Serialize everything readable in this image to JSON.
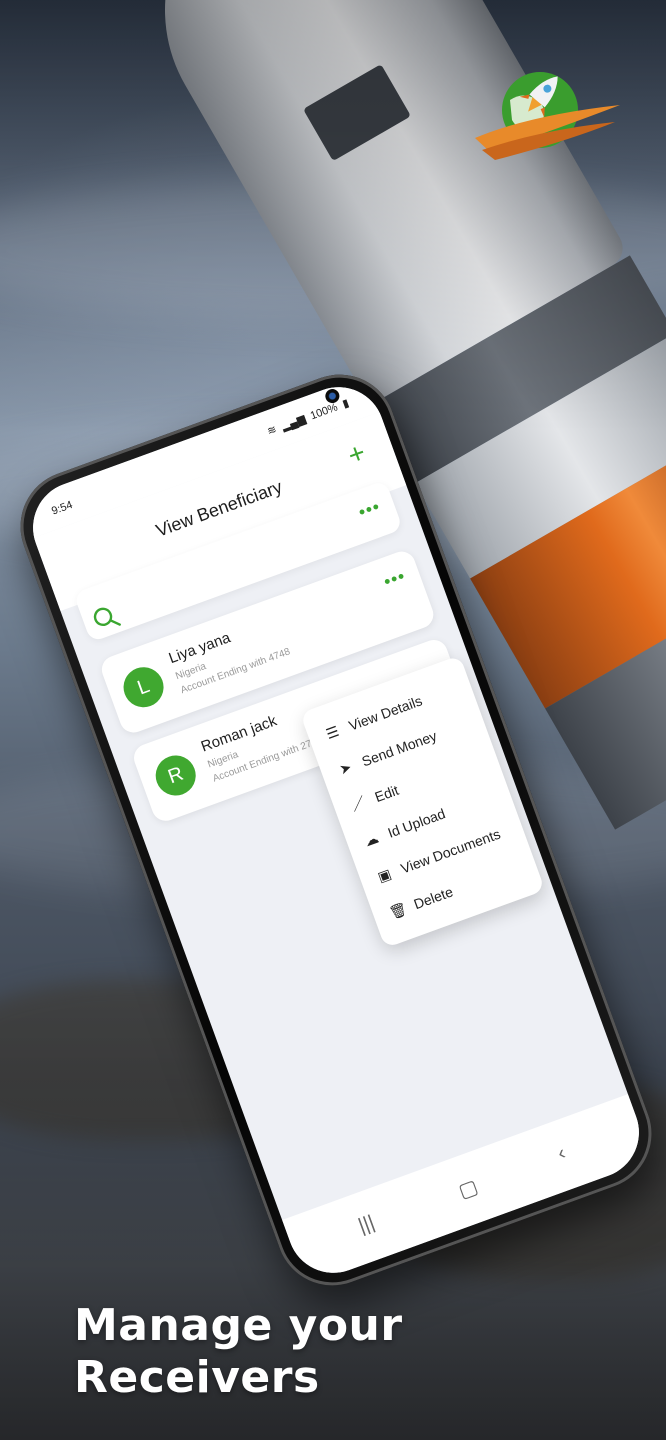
{
  "phone": {
    "status": {
      "time": "9:54",
      "battery": "100%"
    },
    "header": {
      "title": "View Beneficiary"
    },
    "beneficiaries": [
      {
        "initial": "L",
        "name": "Liya yana",
        "country": "Nigeria",
        "account": "Account Ending with 4748"
      },
      {
        "initial": "R",
        "name": "Roman jack",
        "country": "Nigeria",
        "account": "Account Ending with 2737"
      }
    ],
    "menu": [
      {
        "label": "View Details",
        "icon": "list-icon"
      },
      {
        "label": "Send Money",
        "icon": "send-icon"
      },
      {
        "label": "Edit",
        "icon": "edit-icon"
      },
      {
        "label": "Id Upload",
        "icon": "cloud-upload-icon"
      },
      {
        "label": "View Documents",
        "icon": "image-icon"
      },
      {
        "label": "Delete",
        "icon": "trash-icon"
      }
    ],
    "colors": {
      "accent": "#3aa630",
      "avatar": "#40a830"
    }
  },
  "caption": {
    "line1": "Manage your",
    "line2": "Receivers"
  }
}
